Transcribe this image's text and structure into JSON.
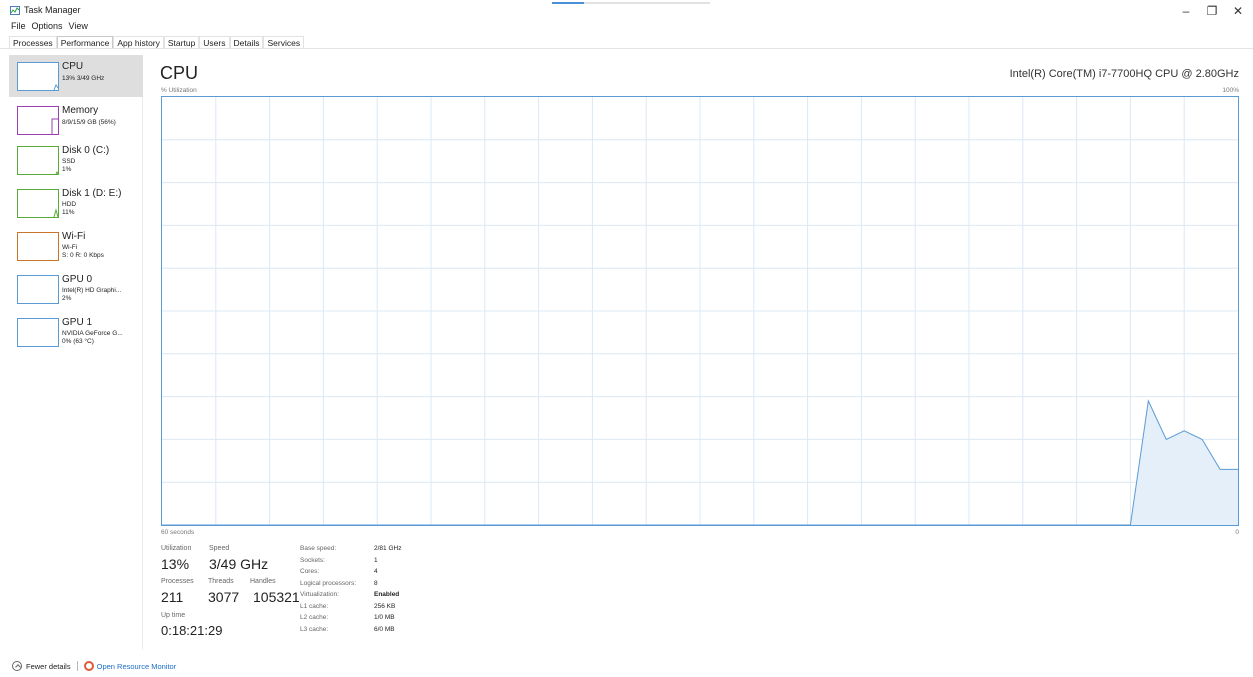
{
  "window": {
    "title": "Task Manager",
    "min_glyph": "–",
    "max_glyph": "❐",
    "close_glyph": "✕"
  },
  "menu": [
    "File",
    "Options",
    "View"
  ],
  "tabs": [
    "Processes",
    "Performance",
    "App history",
    "Startup",
    "Users",
    "Details",
    "Services"
  ],
  "sidebar": [
    {
      "title": "CPU",
      "line1": "13% 3/49 GHz",
      "line2": "",
      "color": "#5a9bd4"
    },
    {
      "title": "Memory",
      "line1": "8/9/15/9 GB (56%)",
      "line2": "",
      "color": "#9b3fb3"
    },
    {
      "title": "Disk 0 (C:)",
      "line1": "SSD",
      "line2": "1%",
      "color": "#5aaa3a"
    },
    {
      "title": "Disk 1 (D: E:)",
      "line1": "HDD",
      "line2": "11%",
      "color": "#5aaa3a"
    },
    {
      "title": "Wi-Fi",
      "line1": "Wi-Fi",
      "line2": "S: 0 R: 0 Kbps",
      "color": "#c8752b"
    },
    {
      "title": "GPU 0",
      "line1": "Intel(R) HD Graphi...",
      "line2": "2%",
      "color": "#5a9bd4"
    },
    {
      "title": "GPU 1",
      "line1": "NVIDIA GeForce G...",
      "line2": "0% (63 °C)",
      "color": "#5a9bd4"
    }
  ],
  "main": {
    "heading": "CPU",
    "model": "Intel(R) Core(TM) i7-7700HQ CPU @ 2.80GHz",
    "y_label": "% Utilization",
    "y_max": "100%",
    "x_left": "60 seconds",
    "x_right": "0"
  },
  "chart_data": {
    "type": "area",
    "title": "",
    "xlabel": "60 seconds",
    "ylabel": "% Utilization",
    "xlim": [
      60,
      0
    ],
    "ylim": [
      0,
      100
    ],
    "grid": true,
    "color": "#5a9bd4",
    "x": [
      60,
      59,
      58,
      57,
      56,
      55,
      54,
      53,
      52,
      51,
      50,
      49,
      48,
      47,
      46,
      45,
      44,
      43,
      42,
      41,
      40,
      39,
      38,
      37,
      36,
      35,
      34,
      33,
      32,
      31,
      30,
      29,
      28,
      27,
      26,
      25,
      24,
      23,
      22,
      21,
      20,
      19,
      18,
      17,
      16,
      15,
      14,
      13,
      12,
      11,
      10,
      9,
      8,
      7,
      6,
      5,
      4,
      3,
      2,
      1,
      0
    ],
    "y": [
      0,
      0,
      0,
      0,
      0,
      0,
      0,
      0,
      0,
      0,
      0,
      0,
      0,
      0,
      0,
      0,
      0,
      0,
      0,
      0,
      0,
      0,
      0,
      0,
      0,
      0,
      0,
      0,
      0,
      0,
      0,
      0,
      0,
      0,
      0,
      0,
      0,
      0,
      0,
      0,
      0,
      0,
      0,
      0,
      0,
      0,
      0,
      0,
      0,
      0,
      0,
      0,
      0,
      0,
      0,
      29,
      20,
      22,
      20,
      13,
      13
    ]
  },
  "stats": {
    "utilization_label": "Utilization",
    "utilization": "13%",
    "speed_label": "Speed",
    "speed": "3/49 GHz",
    "processes_label": "Processes",
    "processes": "211",
    "threads_label": "Threads",
    "threads": "3077",
    "handles_label": "Handles",
    "handles": "105321",
    "uptime_label": "Up time",
    "uptime": "0:18:21:29"
  },
  "specs": [
    {
      "key": "Base speed:",
      "val": "2/81 GHz"
    },
    {
      "key": "Sockets:",
      "val": "1"
    },
    {
      "key": "Cores:",
      "val": "4"
    },
    {
      "key": "Logical processors:",
      "val": "8"
    },
    {
      "key": "Virtualization:",
      "val": "Enabled"
    },
    {
      "key": "L1 cache:",
      "val": "256 KB"
    },
    {
      "key": "L2 cache:",
      "val": "1/0 MB"
    },
    {
      "key": "L3 cache:",
      "val": "6/0 MB"
    }
  ],
  "footer": {
    "fewer_details": "Fewer details",
    "open_monitor": "Open Resource Monitor"
  }
}
